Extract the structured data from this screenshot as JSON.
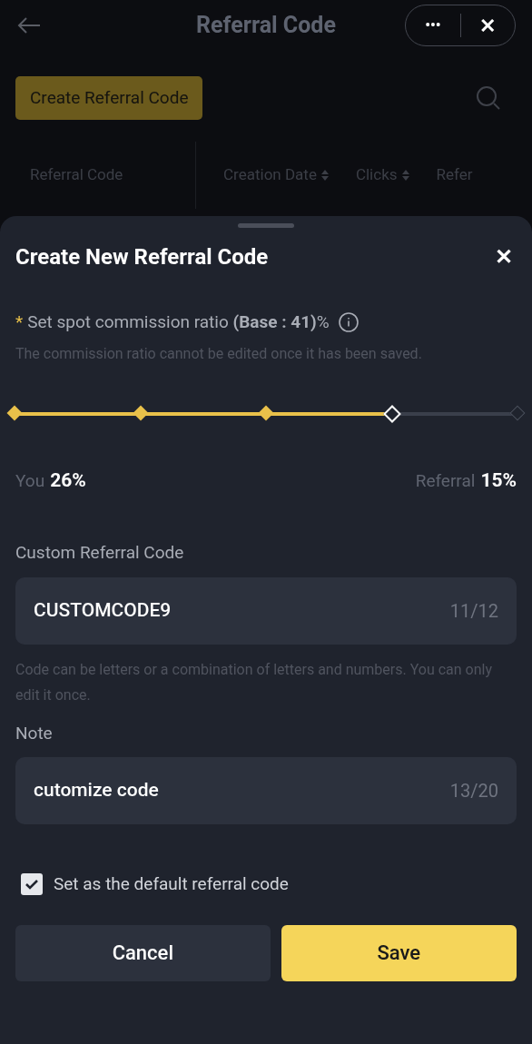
{
  "header": {
    "title": "Referral Code",
    "more": "•••",
    "close": "✕"
  },
  "create_button": "Create Referral Code",
  "table": {
    "columns": [
      {
        "label": "Referral Code",
        "sortable": false
      },
      {
        "label": "Creation Date",
        "sortable": true
      },
      {
        "label": "Clicks",
        "sortable": true
      },
      {
        "label": "Refer",
        "sortable": false
      }
    ]
  },
  "sheet": {
    "title": "Create New Referral Code",
    "close": "✕",
    "ratio": {
      "required_mark": "*",
      "label": "Set spot commission ratio **(Base : 41)**%",
      "hint": "The commission ratio cannot be edited once it has been saved.",
      "level": 0.75,
      "you_label": "You",
      "you_value": "26%",
      "referral_label": "Referral",
      "referral_value": "15%"
    },
    "code": {
      "label": "Custom Referral Code",
      "value": "CUSTOMCODE9",
      "count": "11/12",
      "hint": "Code can be letters or a combination of letters and numbers. You can only edit it once."
    },
    "note": {
      "label": "Note",
      "value": "cutomize code",
      "count": "13/20"
    },
    "default_checkbox": {
      "label": "Set as the default referral code",
      "checked": true
    },
    "buttons": [
      {
        "label": "Cancel",
        "kind": "secondary"
      },
      {
        "label": "Save",
        "kind": "primary"
      }
    ]
  }
}
